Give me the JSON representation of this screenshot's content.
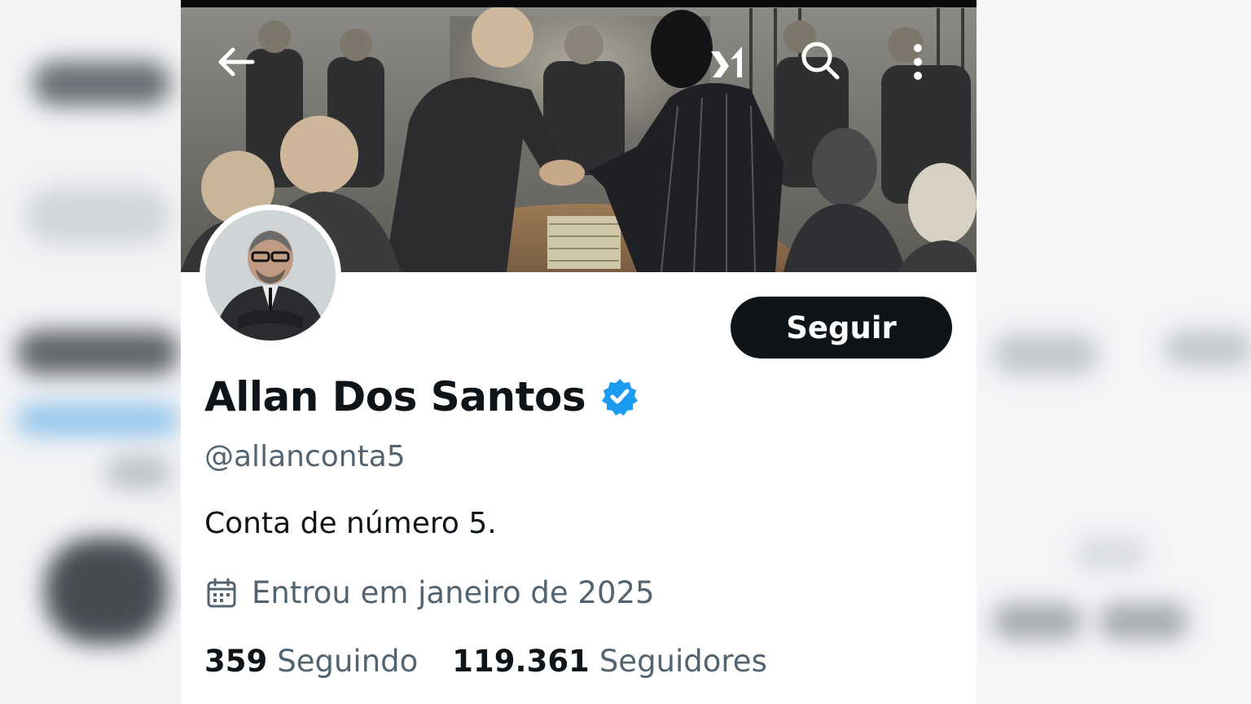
{
  "profile": {
    "display_name": "Allan Dos Santos",
    "verified": true,
    "handle": "@allanconta5",
    "bio": "Conta de número 5.",
    "joined": "Entrou em janeiro de 2025",
    "follow_label": "Seguir",
    "following_count": "359",
    "following_label": "Seguindo",
    "followers_count": "119.361",
    "followers_label": "Seguidores"
  },
  "nav": {
    "back_icon": "arrow-left-icon",
    "grok_icon": "grok-logo-icon",
    "search_icon": "search-icon",
    "more_icon": "more-vertical-icon"
  },
  "colors": {
    "verified": "#1d9bf0",
    "follow_button": "#0f1419",
    "secondary_text": "#536471",
    "primary_text": "#0f1419"
  }
}
